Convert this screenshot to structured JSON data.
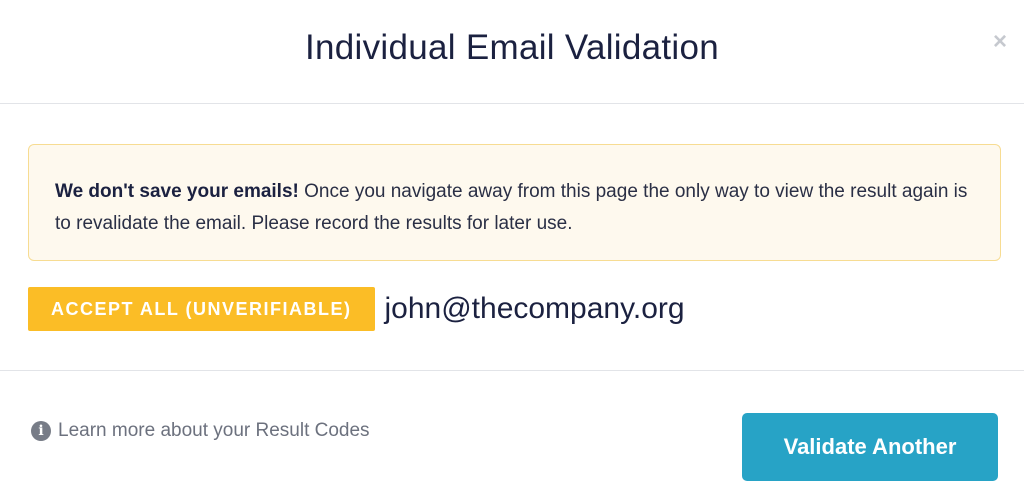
{
  "modal": {
    "title": "Individual Email Validation",
    "close_symbol": "×"
  },
  "notice": {
    "bold_text": "We don't save your emails!",
    "text": " Once you navigate away from this page the only way to view the result again is to revalidate the email. Please record the results for later use."
  },
  "result": {
    "status_label": "ACCEPT ALL (UNVERIFIABLE)",
    "email": "john@thecompany.org"
  },
  "footer": {
    "info_icon": "ⅰ",
    "learn_more_label": "Learn more about your Result Codes",
    "validate_button_label": "Validate Another"
  },
  "colors": {
    "badge": "#fbbd26",
    "button": "#27a3c6",
    "notice_bg": "#fef9ee",
    "notice_border": "#f7dc92"
  }
}
